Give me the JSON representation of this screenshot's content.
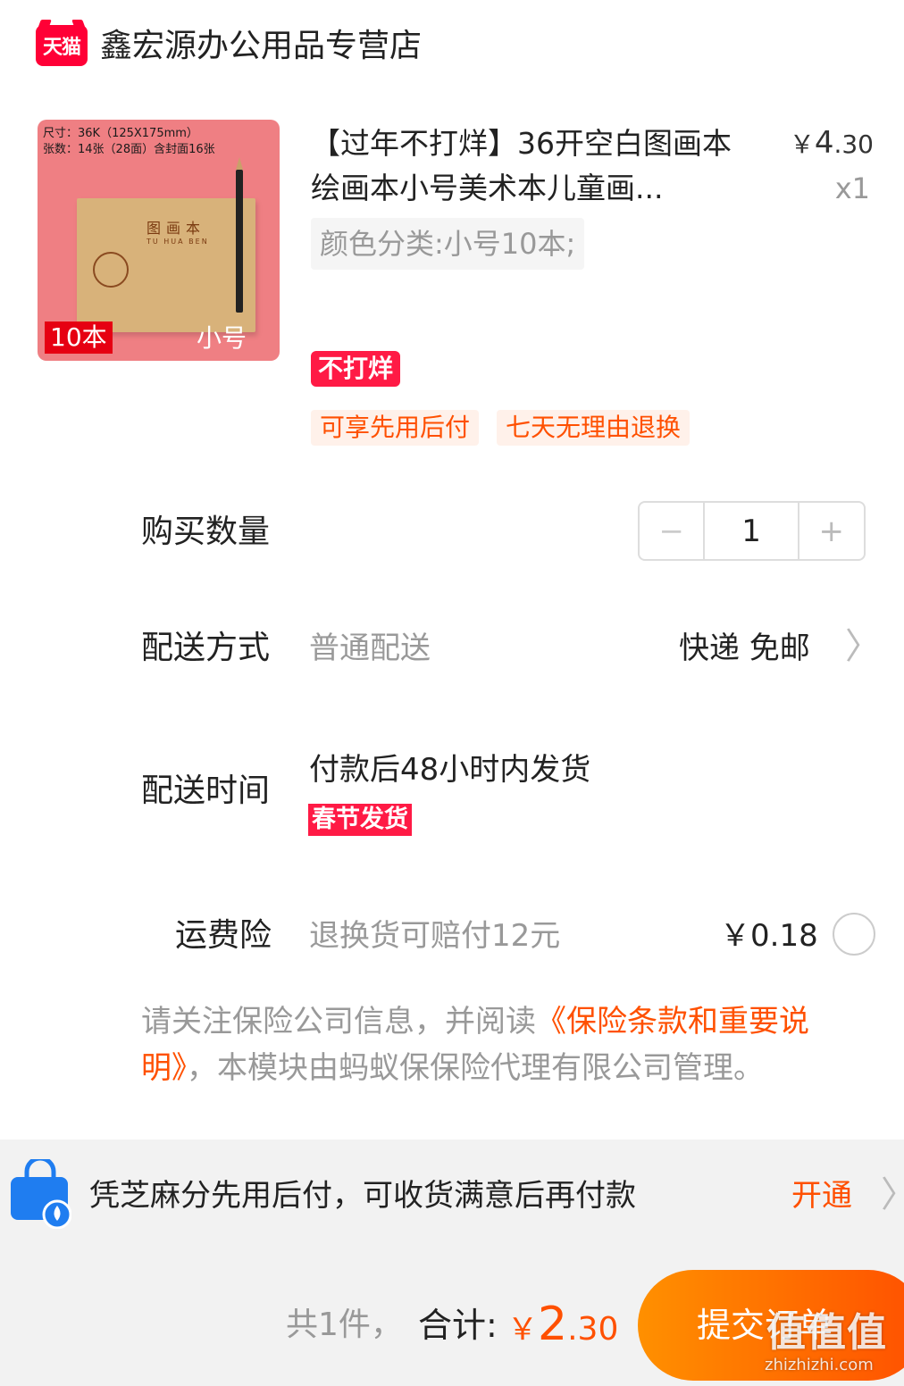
{
  "shop": {
    "logo_text": "天猫",
    "name": "鑫宏源办公用品专营店"
  },
  "product": {
    "image_lines": [
      "尺寸：36K（125X175mm）",
      "张数：14张（28面）含封面16张"
    ],
    "image_book_title": "图画本",
    "image_book_subtitle": "TU HUA BEN",
    "image_tag_left": "10本",
    "image_tag_right": "小号",
    "title": "【过年不打烊】36开空白图画本绘画本小号美术本儿童画...",
    "price_symbol": "￥",
    "price_int": "4",
    "price_dec": ".30",
    "quantity_label": "x1",
    "sku": "颜色分类:小号10本;",
    "badge": "不打烊",
    "tags": [
      "可享先用后付",
      "七天无理由退换"
    ]
  },
  "quantity": {
    "label": "购买数量",
    "minus": "−",
    "value": "1",
    "plus": "+"
  },
  "delivery": {
    "label": "配送方式",
    "method": "普通配送",
    "value": "快递 免邮",
    "chevron": "〉"
  },
  "delivery_time": {
    "label": "配送时间",
    "value": "付款后48小时内发货",
    "badge": "春节发货"
  },
  "insurance": {
    "label": "运费险",
    "desc": "退换货可赔付12元",
    "price": "￥0.18",
    "notice_prefix": "请关注保险公司信息，并阅读",
    "notice_link": "《保险条款和重要说明》",
    "notice_suffix": "，本模块由蚂蚁保保险代理有限公司管理。"
  },
  "credit": {
    "text": "凭芝麻分先用后付，可收货满意后再付款",
    "action": "开通",
    "chevron": "〉"
  },
  "footer": {
    "count": "共1件，",
    "total_label": "合计:",
    "total_symbol": "￥",
    "total_int": "2",
    "total_dec": ".30",
    "submit": "提交订单",
    "watermark": "值值值",
    "watermark_url": "zhizhizhi.com"
  },
  "colors": {
    "brand_red": "#ff0036",
    "accent_orange": "#ff5000",
    "badge_red": "#ff1a45"
  }
}
